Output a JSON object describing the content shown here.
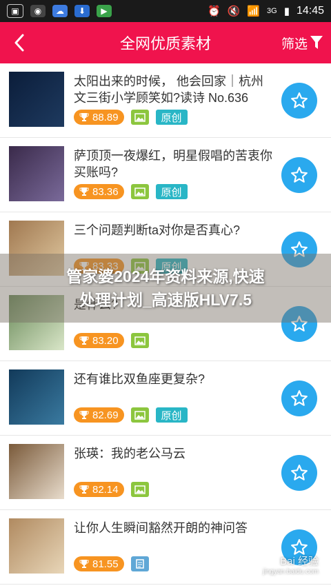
{
  "status_bar": {
    "time": "14:45",
    "network": "3G",
    "signal": "4G"
  },
  "header": {
    "title": "全网优质素材",
    "filter_label": "筛选"
  },
  "items": [
    {
      "title": "太阳出来的时候，   他会回家｜杭州文三街小学顾笑如?读诗 No.636",
      "score": "88.89",
      "original": "原创",
      "type": "image",
      "colors": [
        "#0b1d3a",
        "#1e3a5f"
      ]
    },
    {
      "title": "萨顶顶一夜爆红，明星假唱的苦衷你买账吗?",
      "score": "83.36",
      "original": "原创",
      "type": "image",
      "colors": [
        "#3a2a4a",
        "#7a6a9a"
      ]
    },
    {
      "title": "三个问题判断ta对你是否真心?",
      "score": "83.33",
      "original": "原创",
      "type": "image",
      "colors": [
        "#a07850",
        "#e0c8a0"
      ]
    },
    {
      "title": "是什么?",
      "score": "83.20",
      "original": "",
      "type": "image",
      "colors": [
        "#6a8a5a",
        "#d9e6c8"
      ]
    },
    {
      "title": "还有谁比双鱼座更复杂?",
      "score": "82.69",
      "original": "原创",
      "type": "image",
      "colors": [
        "#123a5a",
        "#3a7aa0"
      ]
    },
    {
      "title": "张瑛：我的老公马云",
      "score": "82.14",
      "original": "",
      "type": "image",
      "colors": [
        "#7a5a3a",
        "#e8dccc"
      ]
    },
    {
      "title": "让你人生瞬间豁然开朗的神问答",
      "score": "81.55",
      "original": "",
      "type": "doc",
      "colors": [
        "#b08a60",
        "#e8d6b8"
      ]
    }
  ],
  "overlay": {
    "line1": "管家婆2024年资料来源,快速",
    "line2": "处理计划_高速版HLV7.5"
  },
  "watermark": {
    "brand": "Bai 经验",
    "url": "jingyan.baidu.com"
  }
}
